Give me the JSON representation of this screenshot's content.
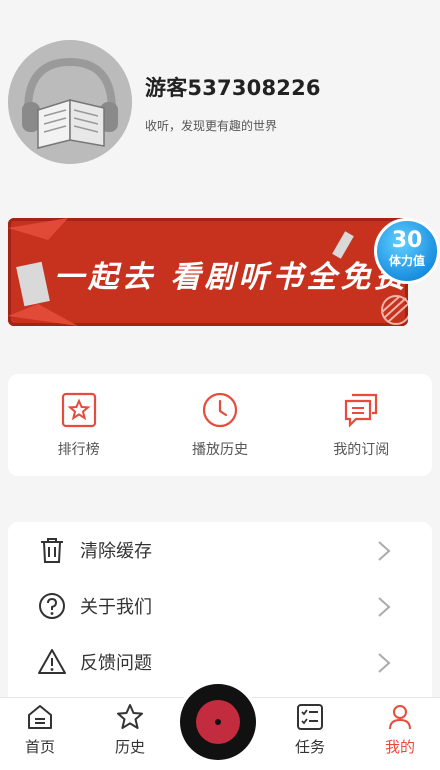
{
  "profile": {
    "username": "游客537308226",
    "tagline": "收听，发现更有趣的世界"
  },
  "banner": {
    "text": "一起去 看剧听书全免费",
    "badge_number": "30",
    "badge_label": "体力值"
  },
  "quick_actions": [
    {
      "label": "排行榜",
      "icon": "star-badge-icon"
    },
    {
      "label": "播放历史",
      "icon": "clock-icon"
    },
    {
      "label": "我的订阅",
      "icon": "chat-bubbles-icon"
    }
  ],
  "menu": [
    {
      "label": "清除缓存",
      "icon": "trash-icon"
    },
    {
      "label": "关于我们",
      "icon": "question-circle-icon"
    },
    {
      "label": "反馈问题",
      "icon": "warning-triangle-icon"
    }
  ],
  "nav": {
    "home": "首页",
    "history": "历史",
    "tasks": "任务",
    "mine": "我的"
  },
  "colors": {
    "accent": "#e64c3c",
    "banner": "#c7321f",
    "badge": "#1c8fe0"
  }
}
